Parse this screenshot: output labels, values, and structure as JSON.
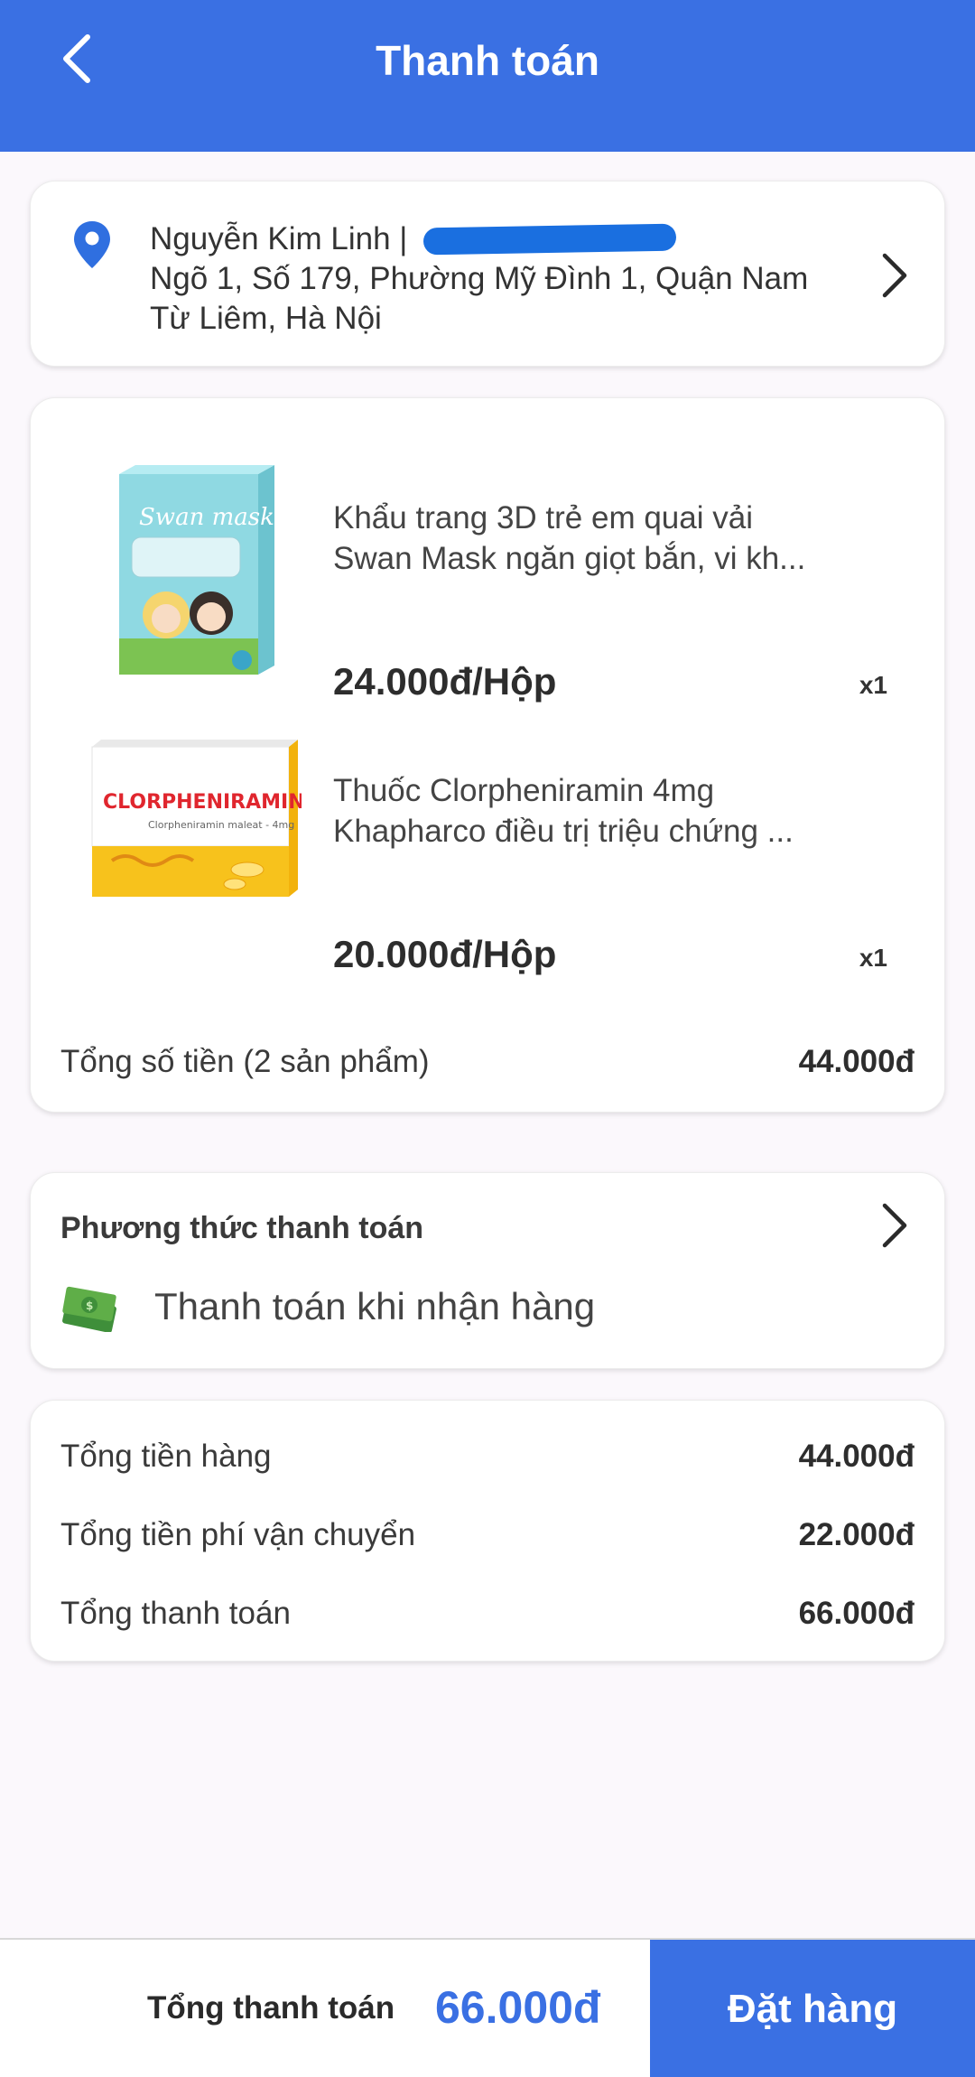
{
  "header": {
    "title": "Thanh toán"
  },
  "address": {
    "name": "Nguyễn Kim Linh |",
    "line1": "Ngõ 1, Số 179, Phường Mỹ Đình 1, Quận Nam",
    "line2": "Từ Liêm, Hà Nội"
  },
  "products": [
    {
      "name_line1": "Khẩu trang 3D trẻ em quai vải",
      "name_line2": "Swan Mask ngăn giọt bắn, vi kh...",
      "price": "24.000đ/Hộp",
      "qty": "x1"
    },
    {
      "name_line1": "Thuốc Clorpheniramin 4mg",
      "name_line2": "Khapharco điều trị triệu chứng ...",
      "price": "20.000đ/Hộp",
      "qty": "x1"
    }
  ],
  "products_total": {
    "label": "Tổng số tiền (2 sản phẩm)",
    "value": "44.000đ"
  },
  "payment": {
    "label": "Phương thức thanh toán",
    "method": "Thanh toán khi nhận hàng",
    "icon": "cash-icon"
  },
  "summary": {
    "goods_label": "Tổng tiền hàng",
    "goods_value": "44.000đ",
    "shipping_label": "Tổng tiền phí vận chuyển",
    "shipping_value": "22.000đ",
    "total_label": "Tổng thanh toán",
    "total_value": "66.000đ"
  },
  "bottom": {
    "total_label": "Tổng thanh toán",
    "total_value": "66.000đ",
    "order_button": "Đặt hàng"
  },
  "colors": {
    "primary": "#3a70e3",
    "background": "#fbf8fc"
  }
}
